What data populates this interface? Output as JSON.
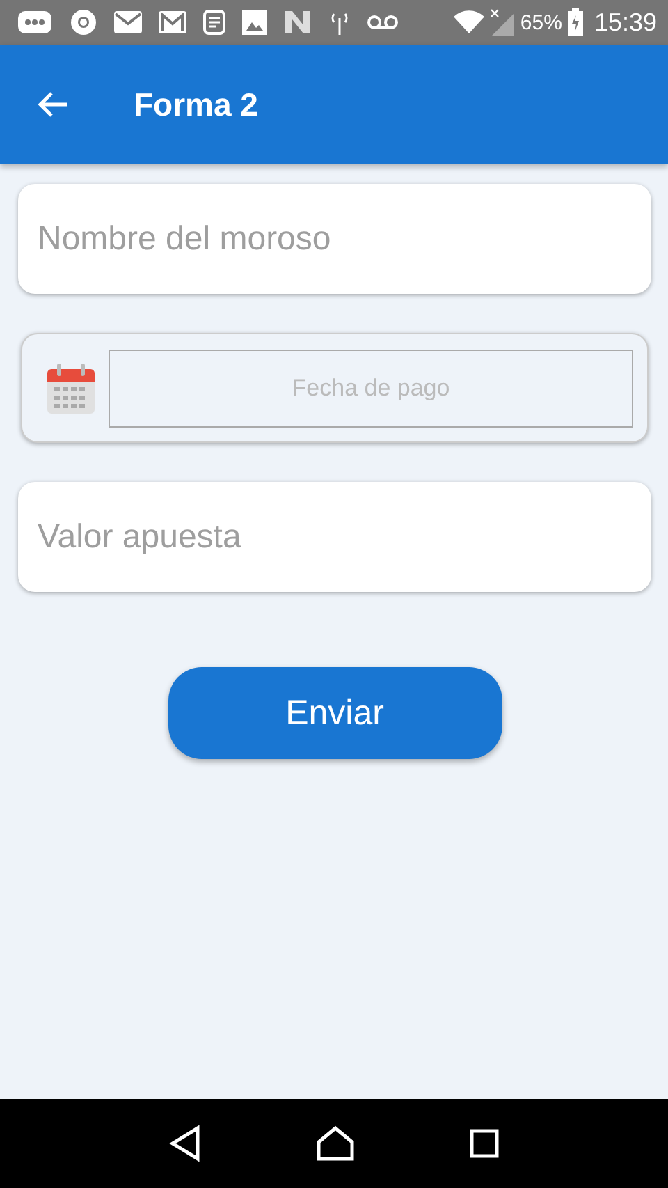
{
  "status_bar": {
    "battery": "65%",
    "time": "15:39"
  },
  "app_bar": {
    "title": "Forma 2"
  },
  "fields": [
    {
      "kind": "text",
      "placeholder": "Nombre del moroso"
    },
    {
      "kind": "date",
      "placeholder": "Fecha de pago"
    },
    {
      "kind": "text",
      "placeholder": "Valor apuesta"
    }
  ],
  "submit": {
    "label": "Enviar"
  }
}
